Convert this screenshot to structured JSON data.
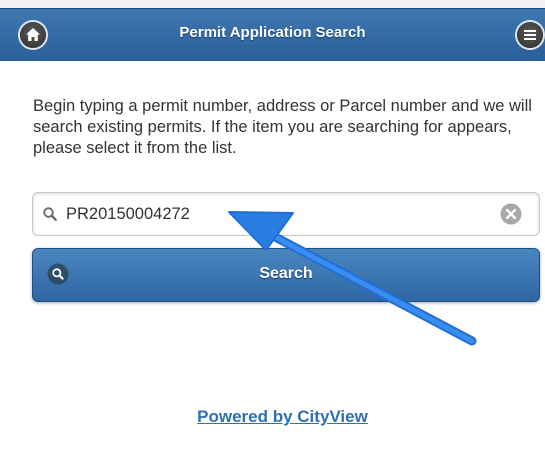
{
  "header": {
    "title": "Permit Application Search",
    "home_icon": "home-icon",
    "menu_icon": "menu-icon"
  },
  "main": {
    "instructions": "Begin typing a permit number, address or Parcel number and we will search existing permits. If the item you are searching for appears, please select it from the list.",
    "search": {
      "value": "PR20150004272",
      "search_icon": "search-icon",
      "clear_icon": "clear-icon"
    },
    "search_button": {
      "label": "Search",
      "icon": "search-icon"
    },
    "footer_link": "Powered by CityView"
  },
  "colors": {
    "header": "#3f78b2",
    "button": "#3a78b5",
    "link": "#2f6fb5",
    "arrow": "#2a7de1"
  }
}
